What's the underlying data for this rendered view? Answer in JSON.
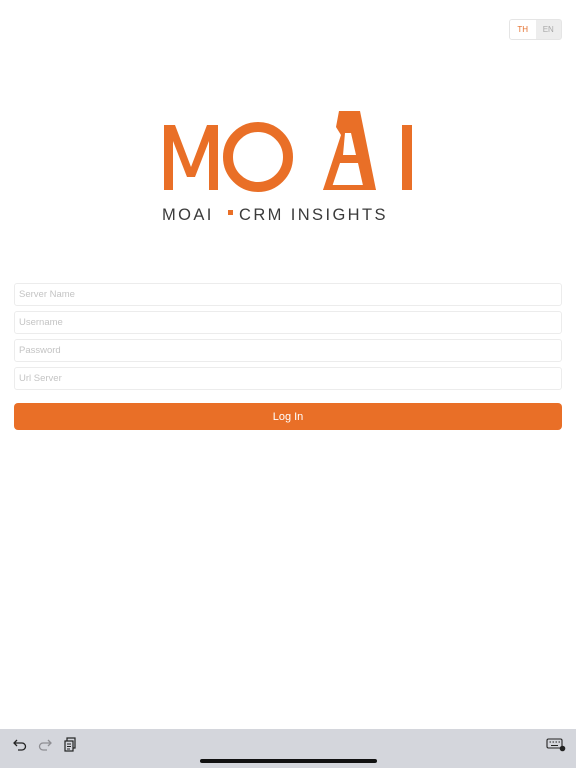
{
  "language_toggle": {
    "options": [
      {
        "code": "TH",
        "active": true
      },
      {
        "code": "EN",
        "active": false
      }
    ]
  },
  "logo": {
    "wordmark": "MOAI",
    "tagline_left": "MOAI",
    "tagline_right": "CRM INSIGHTS",
    "brand_color": "#E96F27",
    "text_color": "#3b3b3b"
  },
  "form": {
    "server_name": {
      "value": "",
      "placeholder": "Server Name"
    },
    "username": {
      "value": "",
      "placeholder": "Username"
    },
    "password": {
      "value": "",
      "placeholder": "Password"
    },
    "url_server": {
      "value": "",
      "placeholder": "Url Server"
    },
    "login_label": "Log In"
  },
  "keyboard_bar": {
    "icons": [
      "undo-icon",
      "redo-icon",
      "paste-icon",
      "keyboard-dismiss-icon"
    ]
  }
}
